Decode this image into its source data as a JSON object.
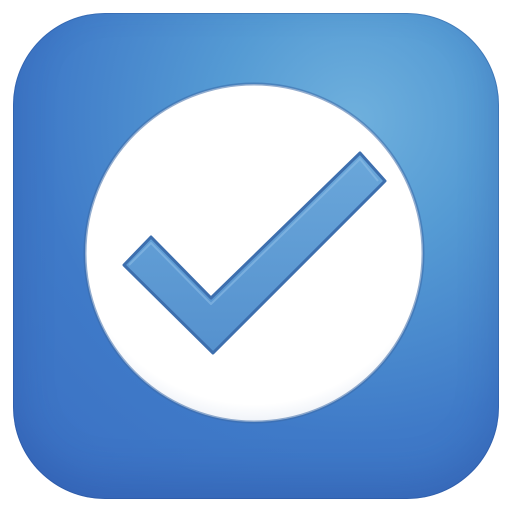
{
  "app_icon": {
    "name": "checkmark-app",
    "colors": {
      "background_light": "#6fb0dd",
      "background_mid": "#559bd4",
      "background_dark": "#3a6fc3",
      "circle_fill": "#ffffff",
      "circle_outline": "#3a6aa8",
      "check_fill": "#5c9bd2",
      "check_stroke": "#3d6fae"
    },
    "icons": {
      "badge": "circle-badge",
      "mark": "checkmark-icon"
    }
  }
}
